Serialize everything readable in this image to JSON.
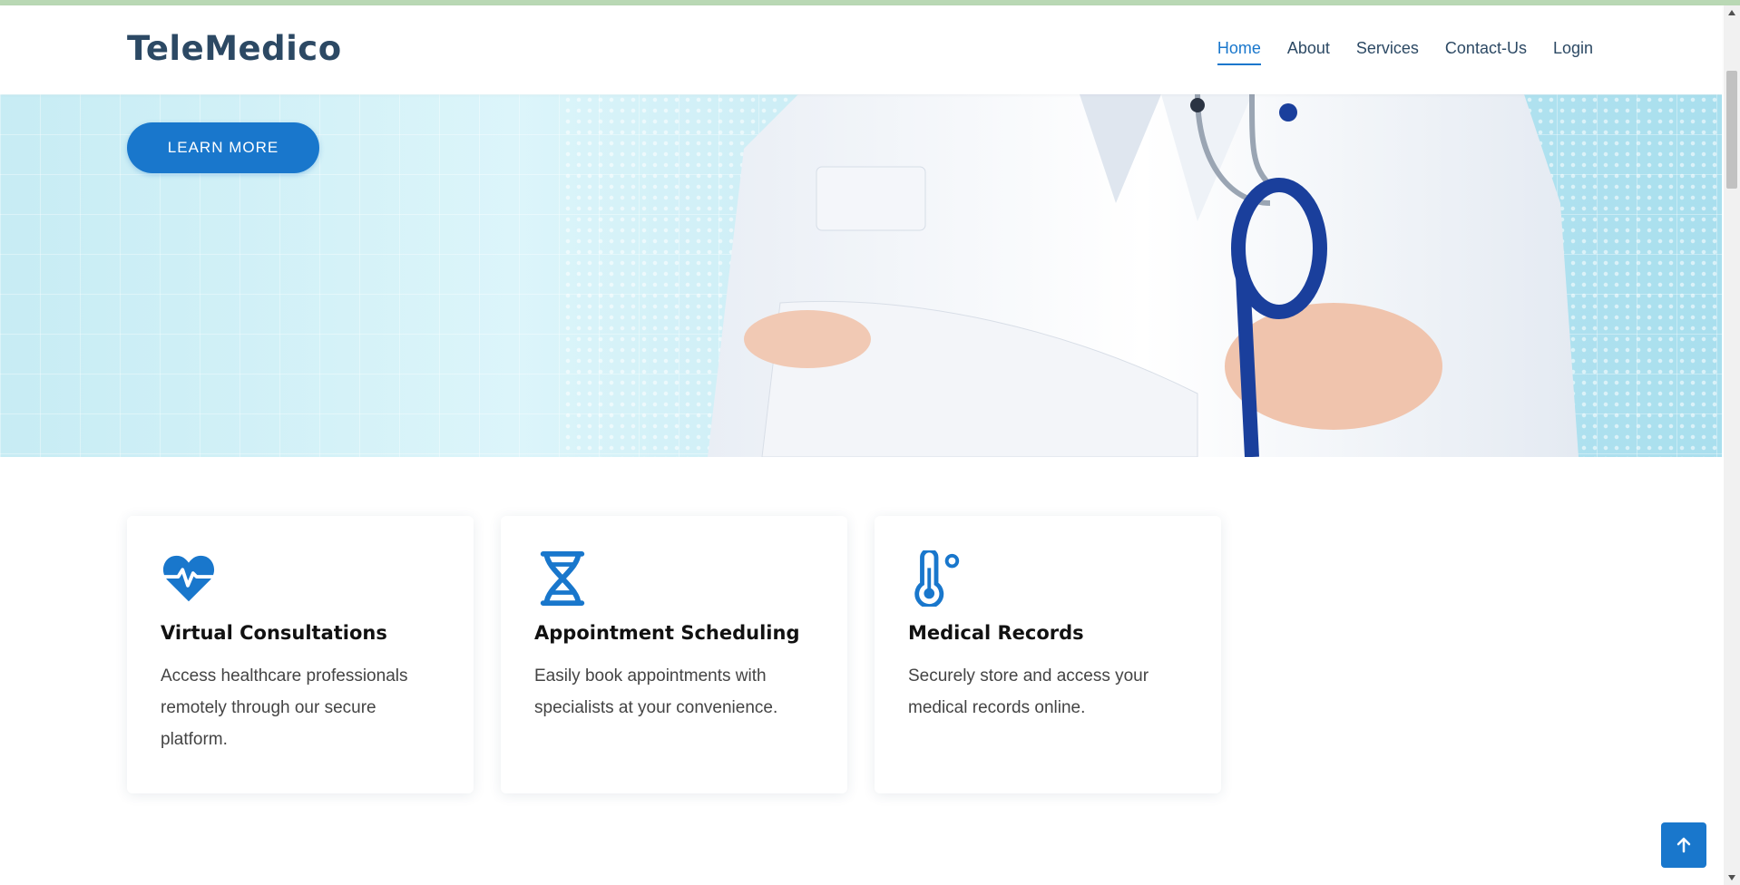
{
  "header": {
    "logo": "TeleMedico",
    "nav": [
      {
        "label": "Home",
        "active": true
      },
      {
        "label": "About",
        "active": false
      },
      {
        "label": "Services",
        "active": false
      },
      {
        "label": "Contact-Us",
        "active": false
      },
      {
        "label": "Login",
        "active": false
      }
    ]
  },
  "hero": {
    "button_label": "LEARN MORE"
  },
  "cards": [
    {
      "icon": "heart-pulse-icon",
      "title": "Virtual Consultations",
      "text": "Access healthcare professionals remotely through our secure platform."
    },
    {
      "icon": "dna-icon",
      "title": "Appointment Scheduling",
      "text": "Easily book appointments with specialists at your convenience."
    },
    {
      "icon": "thermometer-icon",
      "title": "Medical Records",
      "text": "Securely store and access your medical records online."
    }
  ],
  "back_to_top_icon": "arrow-up-icon",
  "colors": {
    "accent": "#1977cc",
    "heading": "#2c4964",
    "text": "#444444"
  }
}
